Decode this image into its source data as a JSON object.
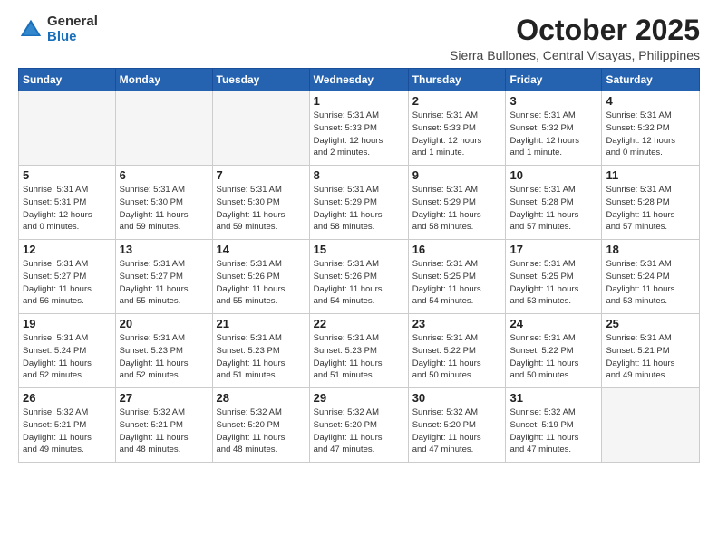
{
  "header": {
    "logo_general": "General",
    "logo_blue": "Blue",
    "month": "October 2025",
    "location": "Sierra Bullones, Central Visayas, Philippines"
  },
  "days_of_week": [
    "Sunday",
    "Monday",
    "Tuesday",
    "Wednesday",
    "Thursday",
    "Friday",
    "Saturday"
  ],
  "weeks": [
    [
      {
        "day": "",
        "info": ""
      },
      {
        "day": "",
        "info": ""
      },
      {
        "day": "",
        "info": ""
      },
      {
        "day": "1",
        "info": "Sunrise: 5:31 AM\nSunset: 5:33 PM\nDaylight: 12 hours\nand 2 minutes."
      },
      {
        "day": "2",
        "info": "Sunrise: 5:31 AM\nSunset: 5:33 PM\nDaylight: 12 hours\nand 1 minute."
      },
      {
        "day": "3",
        "info": "Sunrise: 5:31 AM\nSunset: 5:32 PM\nDaylight: 12 hours\nand 1 minute."
      },
      {
        "day": "4",
        "info": "Sunrise: 5:31 AM\nSunset: 5:32 PM\nDaylight: 12 hours\nand 0 minutes."
      }
    ],
    [
      {
        "day": "5",
        "info": "Sunrise: 5:31 AM\nSunset: 5:31 PM\nDaylight: 12 hours\nand 0 minutes."
      },
      {
        "day": "6",
        "info": "Sunrise: 5:31 AM\nSunset: 5:30 PM\nDaylight: 11 hours\nand 59 minutes."
      },
      {
        "day": "7",
        "info": "Sunrise: 5:31 AM\nSunset: 5:30 PM\nDaylight: 11 hours\nand 59 minutes."
      },
      {
        "day": "8",
        "info": "Sunrise: 5:31 AM\nSunset: 5:29 PM\nDaylight: 11 hours\nand 58 minutes."
      },
      {
        "day": "9",
        "info": "Sunrise: 5:31 AM\nSunset: 5:29 PM\nDaylight: 11 hours\nand 58 minutes."
      },
      {
        "day": "10",
        "info": "Sunrise: 5:31 AM\nSunset: 5:28 PM\nDaylight: 11 hours\nand 57 minutes."
      },
      {
        "day": "11",
        "info": "Sunrise: 5:31 AM\nSunset: 5:28 PM\nDaylight: 11 hours\nand 57 minutes."
      }
    ],
    [
      {
        "day": "12",
        "info": "Sunrise: 5:31 AM\nSunset: 5:27 PM\nDaylight: 11 hours\nand 56 minutes."
      },
      {
        "day": "13",
        "info": "Sunrise: 5:31 AM\nSunset: 5:27 PM\nDaylight: 11 hours\nand 55 minutes."
      },
      {
        "day": "14",
        "info": "Sunrise: 5:31 AM\nSunset: 5:26 PM\nDaylight: 11 hours\nand 55 minutes."
      },
      {
        "day": "15",
        "info": "Sunrise: 5:31 AM\nSunset: 5:26 PM\nDaylight: 11 hours\nand 54 minutes."
      },
      {
        "day": "16",
        "info": "Sunrise: 5:31 AM\nSunset: 5:25 PM\nDaylight: 11 hours\nand 54 minutes."
      },
      {
        "day": "17",
        "info": "Sunrise: 5:31 AM\nSunset: 5:25 PM\nDaylight: 11 hours\nand 53 minutes."
      },
      {
        "day": "18",
        "info": "Sunrise: 5:31 AM\nSunset: 5:24 PM\nDaylight: 11 hours\nand 53 minutes."
      }
    ],
    [
      {
        "day": "19",
        "info": "Sunrise: 5:31 AM\nSunset: 5:24 PM\nDaylight: 11 hours\nand 52 minutes."
      },
      {
        "day": "20",
        "info": "Sunrise: 5:31 AM\nSunset: 5:23 PM\nDaylight: 11 hours\nand 52 minutes."
      },
      {
        "day": "21",
        "info": "Sunrise: 5:31 AM\nSunset: 5:23 PM\nDaylight: 11 hours\nand 51 minutes."
      },
      {
        "day": "22",
        "info": "Sunrise: 5:31 AM\nSunset: 5:23 PM\nDaylight: 11 hours\nand 51 minutes."
      },
      {
        "day": "23",
        "info": "Sunrise: 5:31 AM\nSunset: 5:22 PM\nDaylight: 11 hours\nand 50 minutes."
      },
      {
        "day": "24",
        "info": "Sunrise: 5:31 AM\nSunset: 5:22 PM\nDaylight: 11 hours\nand 50 minutes."
      },
      {
        "day": "25",
        "info": "Sunrise: 5:31 AM\nSunset: 5:21 PM\nDaylight: 11 hours\nand 49 minutes."
      }
    ],
    [
      {
        "day": "26",
        "info": "Sunrise: 5:32 AM\nSunset: 5:21 PM\nDaylight: 11 hours\nand 49 minutes."
      },
      {
        "day": "27",
        "info": "Sunrise: 5:32 AM\nSunset: 5:21 PM\nDaylight: 11 hours\nand 48 minutes."
      },
      {
        "day": "28",
        "info": "Sunrise: 5:32 AM\nSunset: 5:20 PM\nDaylight: 11 hours\nand 48 minutes."
      },
      {
        "day": "29",
        "info": "Sunrise: 5:32 AM\nSunset: 5:20 PM\nDaylight: 11 hours\nand 47 minutes."
      },
      {
        "day": "30",
        "info": "Sunrise: 5:32 AM\nSunset: 5:20 PM\nDaylight: 11 hours\nand 47 minutes."
      },
      {
        "day": "31",
        "info": "Sunrise: 5:32 AM\nSunset: 5:19 PM\nDaylight: 11 hours\nand 47 minutes."
      },
      {
        "day": "",
        "info": ""
      }
    ]
  ]
}
